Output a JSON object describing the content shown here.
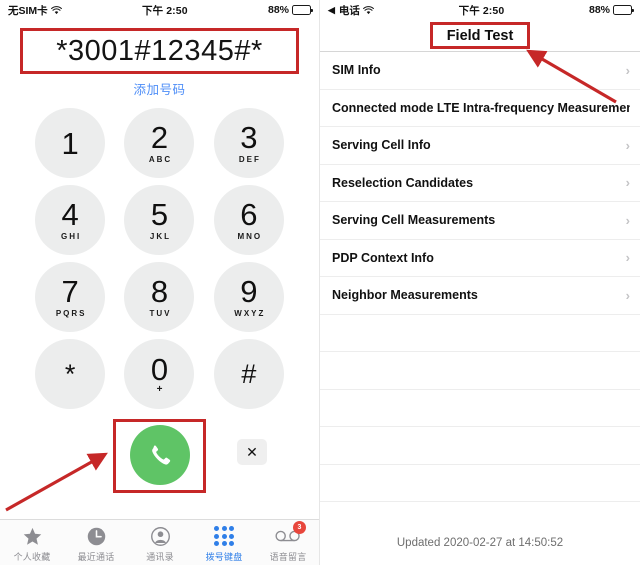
{
  "left": {
    "status_bar": {
      "carrier": "无SIM卡",
      "wifi_icon": "wifi-icon",
      "time": "下午 2:50",
      "battery_percent": "88%",
      "battery_icon": "battery-icon"
    },
    "dialer": {
      "number": "*3001#12345#*",
      "add_number_label": "添加号码",
      "keys": [
        {
          "digit": "1",
          "letters": ""
        },
        {
          "digit": "2",
          "letters": "ABC"
        },
        {
          "digit": "3",
          "letters": "DEF"
        },
        {
          "digit": "4",
          "letters": "GHI"
        },
        {
          "digit": "5",
          "letters": "JKL"
        },
        {
          "digit": "6",
          "letters": "MNO"
        },
        {
          "digit": "7",
          "letters": "PQRS"
        },
        {
          "digit": "8",
          "letters": "TUV"
        },
        {
          "digit": "9",
          "letters": "WXYZ"
        },
        {
          "digit": "*",
          "letters": ""
        },
        {
          "digit": "0",
          "letters": "+"
        },
        {
          "digit": "#",
          "letters": ""
        }
      ],
      "call_button_icon": "phone-handset-icon",
      "delete_button_icon": "backspace-close-icon",
      "delete_button_label": "✕"
    },
    "tabbar": [
      {
        "label": "个人收藏",
        "icon": "star-icon",
        "active": false,
        "badge": ""
      },
      {
        "label": "最近通话",
        "icon": "clock-icon",
        "active": false,
        "badge": ""
      },
      {
        "label": "通讯录",
        "icon": "person-circle-icon",
        "active": false,
        "badge": ""
      },
      {
        "label": "拨号键盘",
        "icon": "keypad-dots-icon",
        "active": true,
        "badge": ""
      },
      {
        "label": "语音留言",
        "icon": "voicemail-icon",
        "active": false,
        "badge": "3"
      }
    ]
  },
  "right": {
    "status_bar": {
      "back_label": "电话",
      "back_icon": "back-caret-icon",
      "wifi_icon": "wifi-icon",
      "time": "下午 2:50",
      "battery_percent": "88%",
      "battery_icon": "battery-icon"
    },
    "nav_title": "Field Test",
    "rows": [
      {
        "label": "SIM Info"
      },
      {
        "label": "Connected mode LTE Intra-frequency Measuremen"
      },
      {
        "label": "Serving Cell Info"
      },
      {
        "label": "Reselection Candidates"
      },
      {
        "label": "Serving Cell Measurements"
      },
      {
        "label": "PDP Context Info"
      },
      {
        "label": "Neighbor Measurements"
      }
    ],
    "chevron": "›",
    "footer": "Updated 2020-02-27 at 14:50:52"
  },
  "annotations": {
    "accent_red": "#c62828",
    "call_arrow": "arrow-pointing-to-call-button",
    "title_arrow": "arrow-pointing-to-field-test-title"
  }
}
